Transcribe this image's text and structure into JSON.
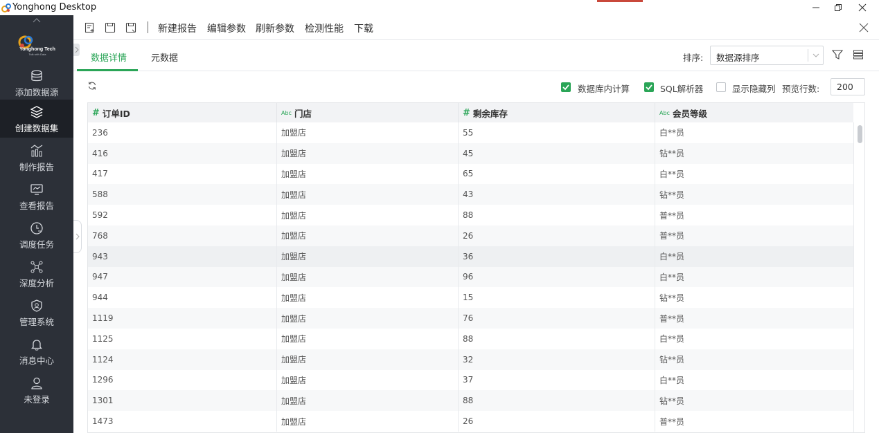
{
  "window": {
    "title": "Yonghong Desktop",
    "controls": [
      "minimize-icon",
      "restore-icon",
      "close-icon"
    ]
  },
  "sidebar": {
    "brand": {
      "name": "Yonghong Tech",
      "tagline": "Talk with Data"
    },
    "items": [
      {
        "label": "添加数据源",
        "icon": "database-icon",
        "active": false
      },
      {
        "label": "创建数据集",
        "icon": "layers-icon",
        "active": true
      },
      {
        "label": "制作报告",
        "icon": "chart-icon",
        "active": false
      },
      {
        "label": "查看报告",
        "icon": "monitor-icon",
        "active": false
      },
      {
        "label": "调度任务",
        "icon": "clock-task-icon",
        "active": false
      },
      {
        "label": "深度分析",
        "icon": "network-icon",
        "active": false
      },
      {
        "label": "管理系统",
        "icon": "shield-user-icon",
        "active": false
      },
      {
        "label": "消息中心",
        "icon": "bell-icon",
        "active": false
      },
      {
        "label": "未登录",
        "icon": "user-icon",
        "active": false
      }
    ]
  },
  "toolbar": {
    "actions": [
      "新建报告",
      "编辑参数",
      "刷新参数",
      "检测性能",
      "下载"
    ]
  },
  "tabs": [
    {
      "label": "数据详情",
      "active": true
    },
    {
      "label": "元数据",
      "active": false
    }
  ],
  "sort": {
    "label": "排序:",
    "value": "数据源排序"
  },
  "options": {
    "db_compute": {
      "label": "数据库内计算",
      "checked": true
    },
    "sql_parser": {
      "label": "SQL解析器",
      "checked": true
    },
    "show_hidden": {
      "label": "显示隐藏列",
      "checked": false
    },
    "preview_rows_label": "预览行数:",
    "preview_rows_value": "200"
  },
  "table": {
    "columns": [
      {
        "type": "#",
        "name": "订单ID"
      },
      {
        "type": "Abc",
        "name": "门店"
      },
      {
        "type": "#",
        "name": "剩余库存"
      },
      {
        "type": "Abc",
        "name": "会员等级"
      }
    ],
    "rows": [
      [
        "236",
        "加盟店",
        "55",
        "白**员"
      ],
      [
        "416",
        "加盟店",
        "45",
        "钻**员"
      ],
      [
        "417",
        "加盟店",
        "65",
        "白**员"
      ],
      [
        "588",
        "加盟店",
        "43",
        "钻**员"
      ],
      [
        "592",
        "加盟店",
        "88",
        "普**员"
      ],
      [
        "768",
        "加盟店",
        "26",
        "普**员"
      ],
      [
        "943",
        "加盟店",
        "36",
        "白**员"
      ],
      [
        "947",
        "加盟店",
        "96",
        "白**员"
      ],
      [
        "944",
        "加盟店",
        "15",
        "钻**员"
      ],
      [
        "1119",
        "加盟店",
        "76",
        "普**员"
      ],
      [
        "1125",
        "加盟店",
        "88",
        "白**员"
      ],
      [
        "1124",
        "加盟店",
        "32",
        "钻**员"
      ],
      [
        "1296",
        "加盟店",
        "37",
        "白**员"
      ],
      [
        "1301",
        "加盟店",
        "88",
        "钻**员"
      ],
      [
        "1473",
        "加盟店",
        "26",
        "普**员"
      ]
    ],
    "highlighted_row": 6
  },
  "colors": {
    "accent": "#2aa557",
    "sidebar_bg": "#2c3038",
    "sidebar_active": "#1d2026"
  }
}
